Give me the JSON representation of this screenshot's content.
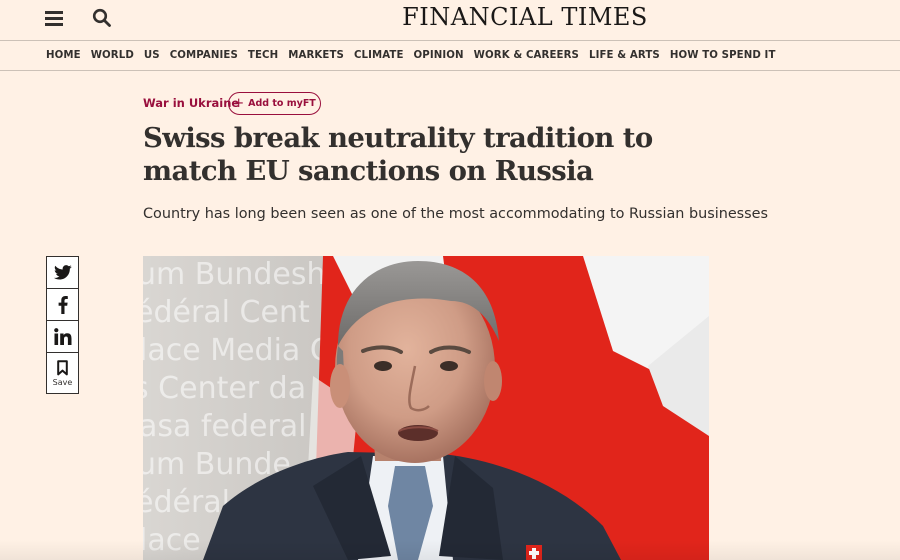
{
  "header": {
    "brand": "FINANCIAL TIMES",
    "menu_icon": "hamburger-menu-icon",
    "search_icon": "search-icon"
  },
  "nav": {
    "items": [
      "HOME",
      "WORLD",
      "US",
      "COMPANIES",
      "TECH",
      "MARKETS",
      "CLIMATE",
      "OPINION",
      "WORK & CAREERS",
      "LIFE & ARTS",
      "HOW TO SPEND IT"
    ]
  },
  "article": {
    "topic": "War in Ukraine",
    "myft_label": "Add to myFT",
    "headline": "Swiss break neutrality tradition to match EU sanctions on Russia",
    "standfirst": "Country has long been seen as one of the most accommodating to Russian businesses",
    "image_backdrop_text": [
      "um Bundesh",
      "édéral  Cent",
      "lace Media C",
      "s  Center da",
      "asa federal",
      "um Bunde",
      "édéral",
      "lace"
    ]
  },
  "share": {
    "twitter_icon": "twitter-icon",
    "facebook_icon": "facebook-icon",
    "linkedin_icon": "linkedin-icon",
    "save_icon": "bookmark-icon",
    "save_label": "Save"
  },
  "colors": {
    "page_background": "#fff1e5",
    "accent": "#990f3d",
    "text": "#33302e",
    "flag_red": "#e1251b"
  }
}
